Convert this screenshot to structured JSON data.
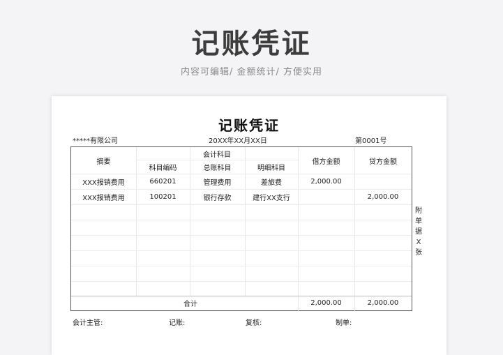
{
  "hero": {
    "title": "记账凭证",
    "subtitle": "内容可编辑/ 金额统计/ 方便实用"
  },
  "voucher": {
    "title": "记账凭证",
    "company": "*****有限公司",
    "date": "20XX年XX月XX日",
    "number": "第0001号",
    "headers": {
      "summary": "摘要",
      "account_group": "会计科目",
      "account_code": "科目编码",
      "general_ledger": "总账科目",
      "detail_account": "明细科目",
      "debit": "借方金额",
      "credit": "贷方金额"
    },
    "rows": [
      {
        "summary": "XXX报销费用",
        "code": "660201",
        "general": "管理费用",
        "detail": "差旅费",
        "debit": "2,000.00",
        "credit": ""
      },
      {
        "summary": "XXX报销费用",
        "code": "100201",
        "general": "银行存款",
        "detail": "建行XX支行",
        "debit": "",
        "credit": "2,000.00"
      }
    ],
    "total_label": "合计",
    "total_debit": "2,000.00",
    "total_credit": "2,000.00",
    "attachment_note": "附单据X张",
    "footer": {
      "supervisor": "会计主管:",
      "bookkeeper": "记账:",
      "reviewer": "复核:",
      "preparer": "制单:"
    }
  }
}
